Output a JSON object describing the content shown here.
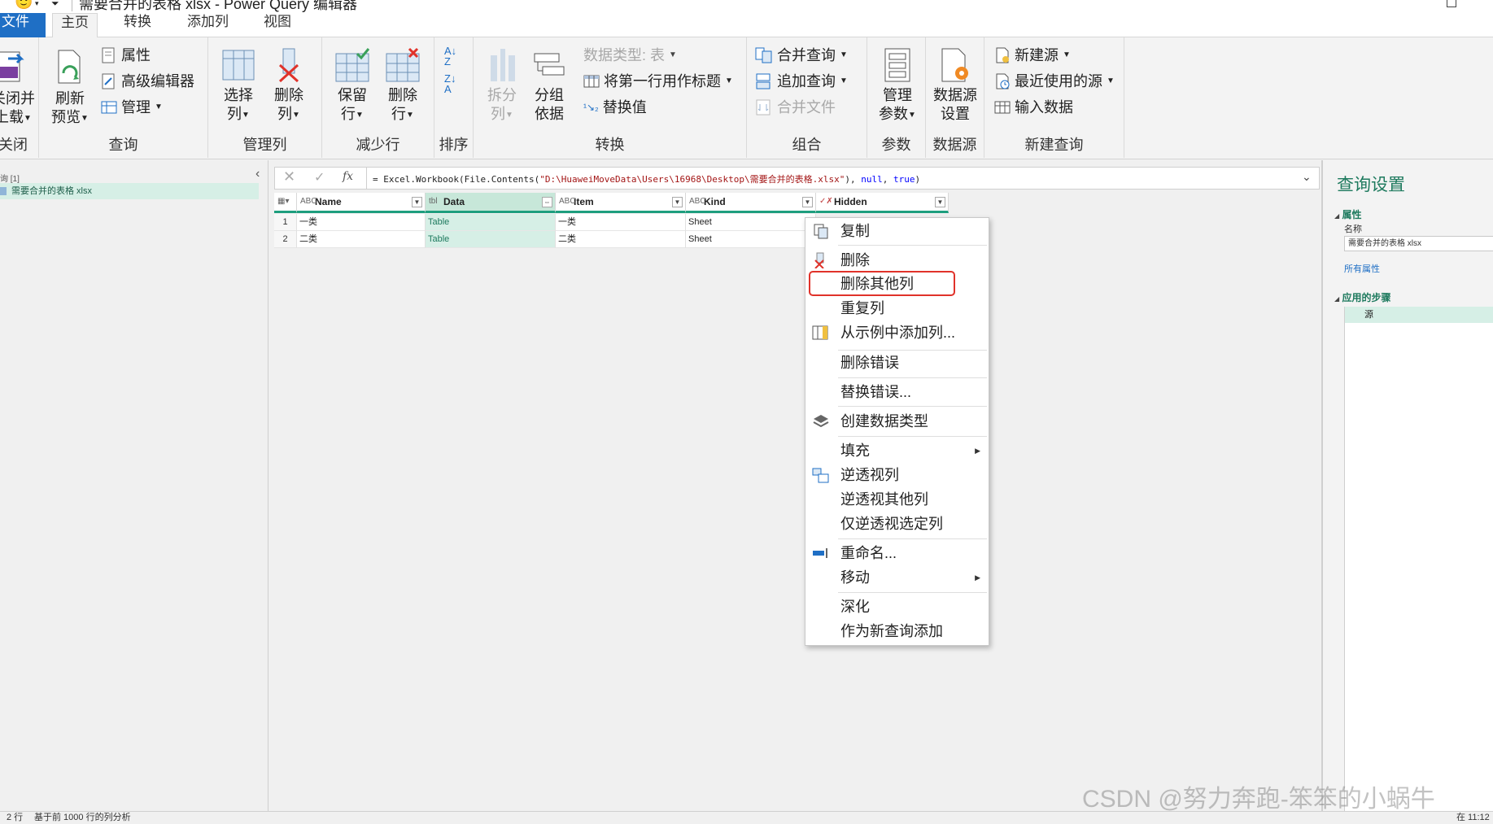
{
  "window": {
    "title": "需要合并的表格 xlsx - Power Query 编辑器",
    "smiley_icon": "smiley-face-icon",
    "restore_icon": "restore-window-icon"
  },
  "tabs": [
    "文件",
    "主页",
    "转换",
    "添加列",
    "视图"
  ],
  "ribbon": {
    "close_load": {
      "label_line1": "关闭并",
      "label_line2": "上载",
      "group": "关闭"
    },
    "query": {
      "refresh_line1": "刷新",
      "refresh_line2": "预览",
      "properties": "属性",
      "advanced_editor": "高级编辑器",
      "manage": "管理",
      "group": "查询"
    },
    "manage_columns": {
      "choose_line1": "选择",
      "choose_line2": "列",
      "remove_line1": "删除",
      "remove_line2": "列",
      "group": "管理列"
    },
    "reduce_rows": {
      "keep_line1": "保留",
      "keep_line2": "行",
      "remove_line1": "删除",
      "remove_line2": "行",
      "group": "减少行"
    },
    "sort": {
      "group": "排序"
    },
    "transform": {
      "split_line1": "拆分",
      "split_line2": "列",
      "groupby_line1": "分组",
      "groupby_line2": "依据",
      "data_type": "数据类型: 表",
      "first_row_header": "将第一行用作标题",
      "replace_values": "替换值",
      "group": "转换"
    },
    "combine": {
      "merge_queries": "合并查询",
      "append_queries": "追加查询",
      "combine_files": "合并文件",
      "group": "组合"
    },
    "parameters": {
      "manage_line1": "管理",
      "manage_line2": "参数",
      "group": "参数"
    },
    "data_source": {
      "settings_line1": "数据源",
      "settings_line2": "设置",
      "group": "数据源"
    },
    "new_query": {
      "new_source": "新建源",
      "recent_sources": "最近使用的源",
      "enter_data": "输入数据",
      "group": "新建查询"
    }
  },
  "queries_pane": {
    "header": "询 [1]",
    "item": "需要合并的表格 xlsx"
  },
  "formula": {
    "prefix": "= Excel.Workbook(File.Contents(",
    "path": "\"D:\\HuaweiMoveData\\Users\\16968\\Desktop\\需要合并的表格.xlsx\"",
    "mid": "), ",
    "null_kw": "null",
    "comma": ", ",
    "true_kw": "true",
    "suffix": ")"
  },
  "grid": {
    "columns": [
      {
        "name": "Name",
        "type": "ABC"
      },
      {
        "name": "Data",
        "type": "tbl"
      },
      {
        "name": "Item",
        "type": "ABC"
      },
      {
        "name": "Kind",
        "type": "ABC"
      },
      {
        "name": "Hidden",
        "type": "✓✗"
      }
    ],
    "rows": [
      {
        "n": "1",
        "name": "一类",
        "data": "Table",
        "item": "一类",
        "kind": "Sheet"
      },
      {
        "n": "2",
        "name": "二类",
        "data": "Table",
        "item": "二类",
        "kind": "Sheet"
      }
    ]
  },
  "context_menu": {
    "copy": "复制",
    "remove": "删除",
    "remove_other": "删除其他列",
    "duplicate": "重复列",
    "add_from_examples": "从示例中添加列...",
    "remove_errors": "删除错误",
    "replace_errors": "替换错误...",
    "create_data_type": "创建数据类型",
    "fill": "填充",
    "unpivot": "逆透视列",
    "unpivot_other": "逆透视其他列",
    "unpivot_selected": "仅逆透视选定列",
    "rename": "重命名...",
    "move": "移动",
    "drill_down": "深化",
    "add_as_new_query": "作为新查询添加"
  },
  "settings": {
    "title": "查询设置",
    "properties": "属性",
    "name_label": "名称",
    "name_value": "需要合并的表格 xlsx",
    "all_properties": "所有属性",
    "applied_steps": "应用的步骤",
    "step_1": "源"
  },
  "status": {
    "rows": "2 行",
    "profiling": "基于前 1000 行的列分析",
    "time": "在 11:12"
  },
  "watermark": "CSDN @努力奔跑-笨笨的小蜗牛",
  "colors": {
    "accent": "#1e9e7e",
    "highlight": "#e0322a",
    "file_tab": "#1f6fc5"
  }
}
